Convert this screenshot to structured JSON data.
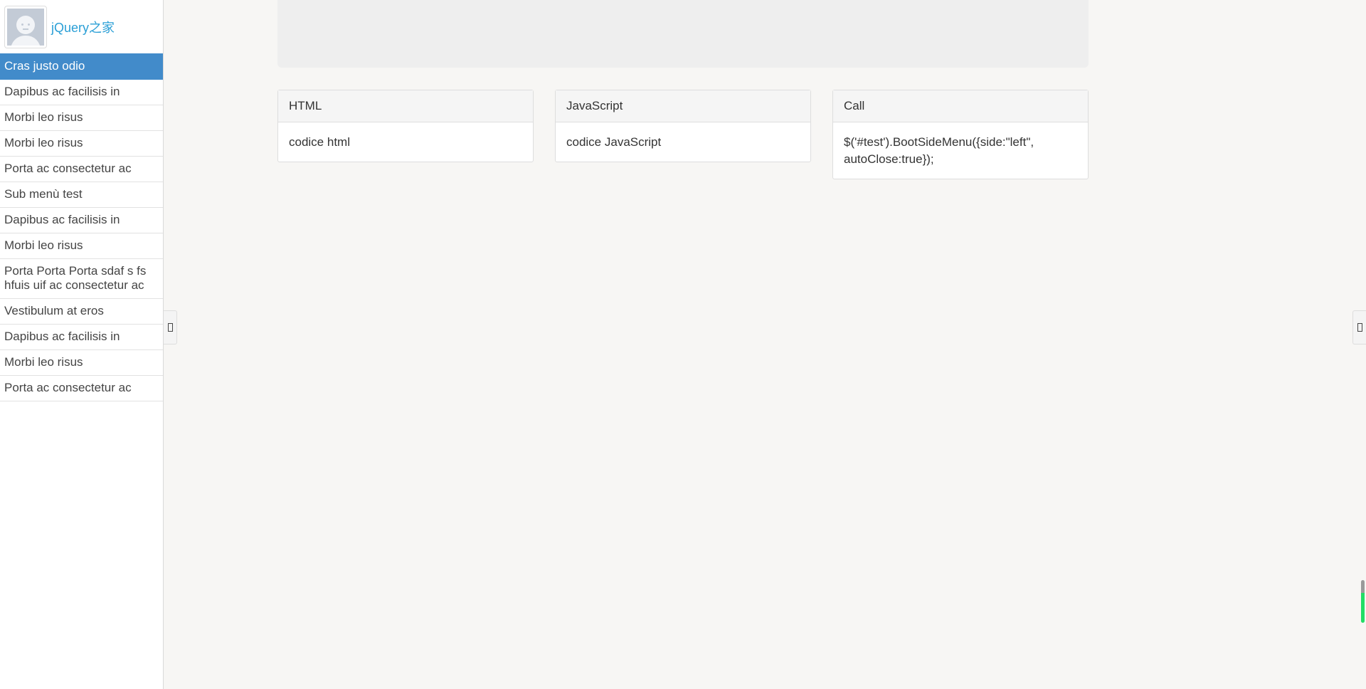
{
  "sidebar": {
    "user_name": "jQuery之家",
    "items": [
      {
        "label": "Cras justo odio",
        "active": true
      },
      {
        "label": "Dapibus ac facilisis in"
      },
      {
        "label": "Morbi leo risus"
      },
      {
        "label": "Morbi leo risus"
      },
      {
        "label": "Porta ac consectetur ac"
      },
      {
        "label": "Sub menù test"
      },
      {
        "label": "Dapibus ac facilisis in"
      },
      {
        "label": "Morbi leo risus"
      },
      {
        "label": "Porta Porta Porta sdaf s fs hfuis uif ac consectetur ac"
      },
      {
        "label": "Vestibulum at eros"
      },
      {
        "label": "Dapibus ac facilisis in"
      },
      {
        "label": "Morbi leo risus"
      },
      {
        "label": "Porta ac consectetur ac"
      }
    ]
  },
  "panels": [
    {
      "title": "HTML",
      "body": "codice html"
    },
    {
      "title": "JavaScript",
      "body": "codice JavaScript"
    },
    {
      "title": "Call",
      "body": "$('#test').BootSideMenu({side:\"left\", autoClose:true});"
    }
  ],
  "colors": {
    "active_bg": "#428bca",
    "link": "#2a9fd6",
    "page_bg": "#f7f6f4"
  }
}
